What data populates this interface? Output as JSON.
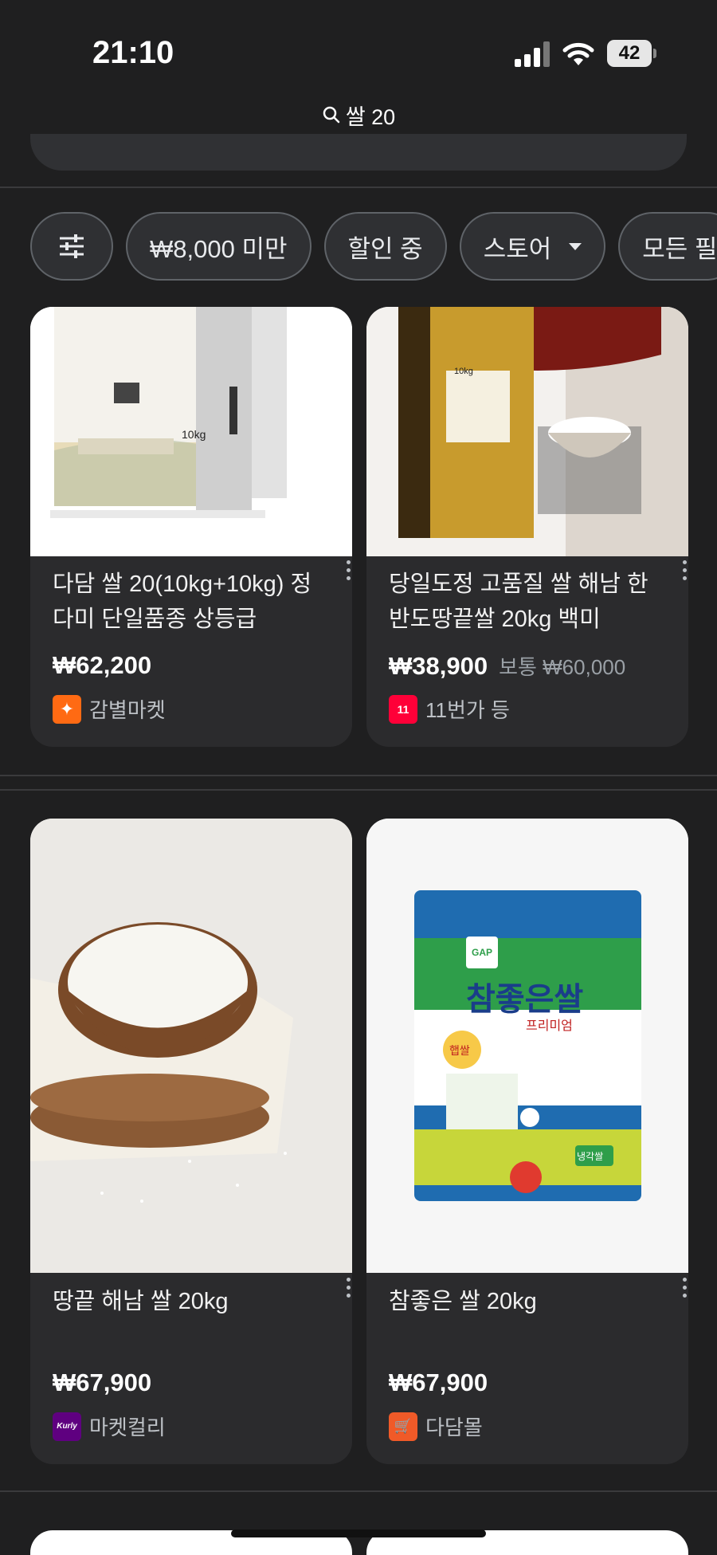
{
  "status_bar": {
    "time": "21:10",
    "battery": "42"
  },
  "url_bar": {
    "text": "쌀 20"
  },
  "chips": [
    {
      "label": "₩8,000 미만"
    },
    {
      "label": "할인 중"
    },
    {
      "label": "스토어"
    },
    {
      "label": "모든 필"
    }
  ],
  "products": [
    {
      "title": "다담 쌀 20(10kg+10kg) 정다미 단일품종 상등급",
      "price": "₩62,200",
      "old_price": "",
      "store": "감별마켓"
    },
    {
      "title": "당일도정 고품질 쌀 해남 한반도땅끝쌀 20kg 백미",
      "price": "₩38,900",
      "old_price": "보통 ₩60,000",
      "store": "11번가 등"
    },
    {
      "title": "땅끝 해남 쌀 20kg",
      "price": "₩67,900",
      "old_price": "",
      "store": "마켓컬리"
    },
    {
      "title": "참좋은 쌀 20kg",
      "price": "₩67,900",
      "old_price": "",
      "store": "다담몰"
    }
  ],
  "product_images": {
    "p1_bag_weight": "10kg",
    "p2_bag_weight": "10kg",
    "p4_brand": "참좋은쌀",
    "p4_sub": "프리미엄",
    "p4_badge": "GAP",
    "p4_tag": "햅쌀",
    "p4_stamp": "냉각쌀"
  },
  "store_logos": {
    "store1_symbol": "✦",
    "store2_symbol": "11",
    "store3_symbol": "Kurly",
    "store4_symbol": "🛒"
  },
  "colors": {
    "background": "#1f1f20",
    "card": "#2b2b2d",
    "chip_border": "#5f6368",
    "store1": "#ff6a13",
    "store2": "#ff0038",
    "store3": "#5f0080",
    "store4": "#f05a28"
  }
}
